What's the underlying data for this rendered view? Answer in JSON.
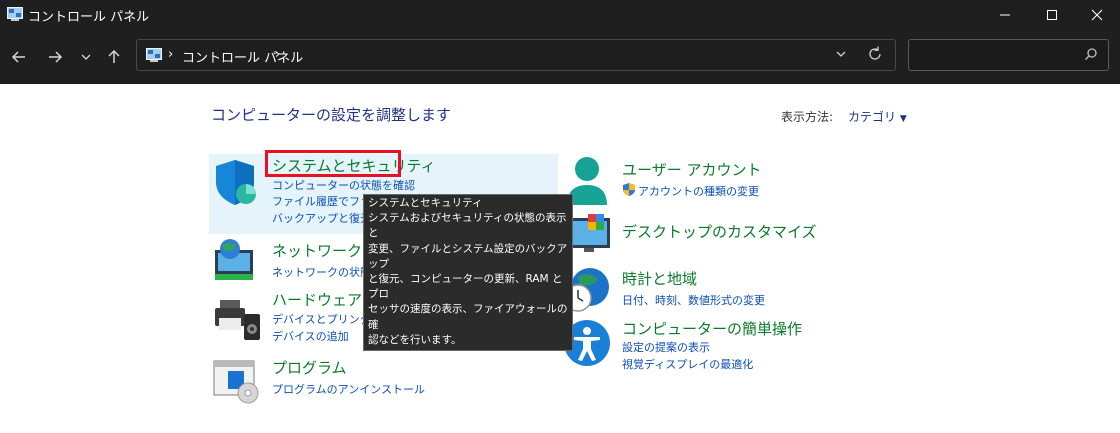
{
  "window": {
    "title": "コントロール パネル",
    "minimize_icon": "minimize-icon",
    "maximize_icon": "maximize-icon",
    "close_icon": "close-icon"
  },
  "nav": {
    "back_icon": "arrow-left-icon",
    "forward_icon": "arrow-right-icon",
    "recent_icon": "chevron-down-icon",
    "up_icon": "arrow-up-icon",
    "address": {
      "separator": "›",
      "crumb": "コントロール パネル",
      "trailing_separator": "›"
    },
    "search": {
      "value": "",
      "placeholder": ""
    }
  },
  "main": {
    "heading": "コンピューターの設定を調整します",
    "view_by": {
      "label": "表示方法:",
      "value": "カテゴリ"
    },
    "categories": [
      {
        "title": "システムとセキュリティ",
        "links": [
          "コンピューターの状態を確認",
          "ファイル履歴でファイ",
          "バックアップと復元"
        ]
      },
      {
        "title": "ネットワークとイ",
        "links": [
          "ネットワークの状態を"
        ]
      },
      {
        "title": "ハードウェアとサウンド",
        "links": [
          "デバイスとプリンターの表示",
          "デバイスの追加"
        ]
      },
      {
        "title": "プログラム",
        "links": [
          "プログラムのアンインストール"
        ]
      },
      {
        "title": "ユーザー アカウント",
        "links": [
          "アカウントの種類の変更"
        ]
      },
      {
        "title": "デスクトップのカスタマイズ",
        "links": []
      },
      {
        "title": "時計と地域",
        "links": [
          "日付、時刻、数値形式の変更"
        ]
      },
      {
        "title": "コンピューターの簡単操作",
        "links": [
          "設定の提案の表示",
          "視覚ディスプレイの最適化"
        ]
      }
    ]
  },
  "tooltip": {
    "lines": [
      "システムとセキュリティ",
      "システムおよびセキュリティの状態の表示と",
      "変更、ファイルとシステム設定のバックアップ",
      "と復元、コンピューターの更新、RAM とプロ",
      "セッサの速度の表示、ファイアウォールの確",
      "認などを行います。"
    ]
  }
}
